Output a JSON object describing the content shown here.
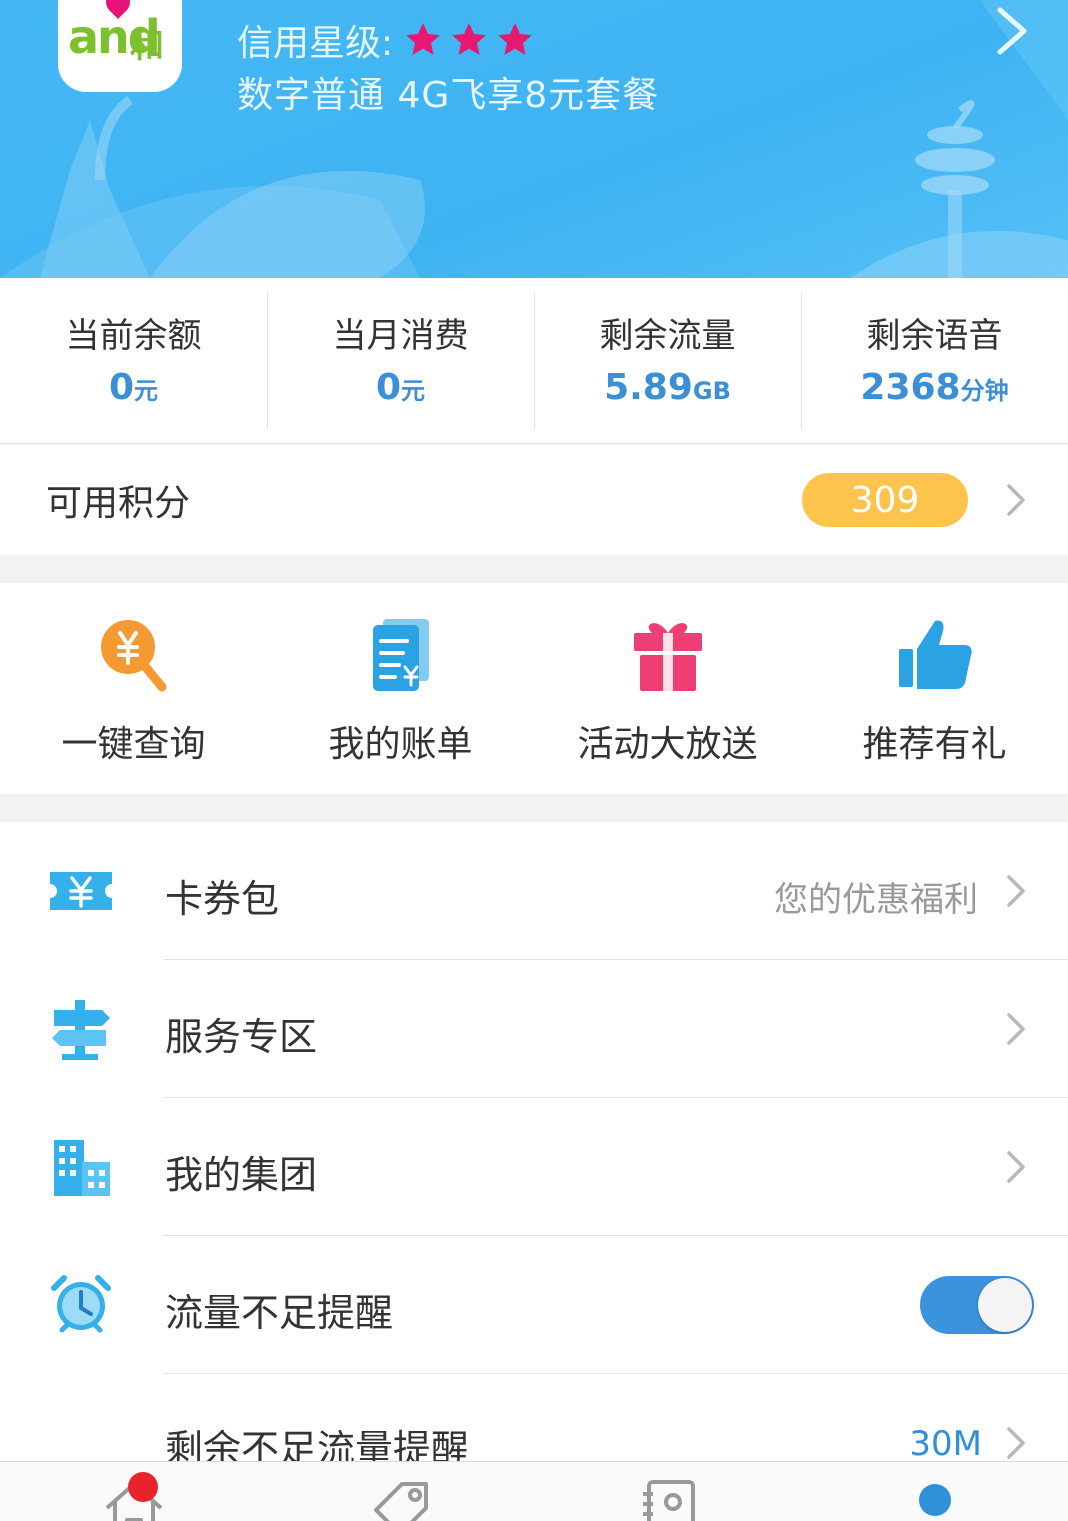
{
  "header": {
    "logo_text": "and",
    "logo_he": "和",
    "credit_label": "信用星级:",
    "credit_stars": 3,
    "plan": "数字普通  4G飞享8元套餐",
    "colors": {
      "bg": "#42b6f3",
      "star": "#e6186f"
    }
  },
  "stats": [
    {
      "label": "当前余额",
      "value": "0",
      "unit": "元"
    },
    {
      "label": "当月消费",
      "value": "0",
      "unit": "元"
    },
    {
      "label": "剩余流量",
      "value": "5.89",
      "unit": "GB"
    },
    {
      "label": "剩余语音",
      "value": "2368",
      "unit": "分钟"
    }
  ],
  "points": {
    "label": "可用积分",
    "value": "309",
    "badge_color": "#fdc44d"
  },
  "quick_actions": [
    {
      "label": "一键查询",
      "icon": "search-yen-icon"
    },
    {
      "label": "我的账单",
      "icon": "bill-icon"
    },
    {
      "label": "活动大放送",
      "icon": "gift-icon"
    },
    {
      "label": "推荐有礼",
      "icon": "thumbs-up-icon"
    }
  ],
  "menu": {
    "coupon": {
      "label": "卡券包",
      "hint": "您的优惠福利",
      "icon": "coupon-icon"
    },
    "service": {
      "label": "服务专区",
      "icon": "signpost-icon"
    },
    "group": {
      "label": "我的集团",
      "icon": "building-icon"
    },
    "data_alert": {
      "label": "流量不足提醒",
      "icon": "alarm-clock-icon",
      "toggle_on": true
    },
    "remaining_alert": {
      "label": "剩余不足流量提醒",
      "value": "30M"
    }
  },
  "bottom_nav": [
    {
      "icon": "home-icon",
      "badge": true
    },
    {
      "icon": "tag-icon"
    },
    {
      "icon": "contacts-icon"
    },
    {
      "icon": "profile-icon"
    }
  ]
}
